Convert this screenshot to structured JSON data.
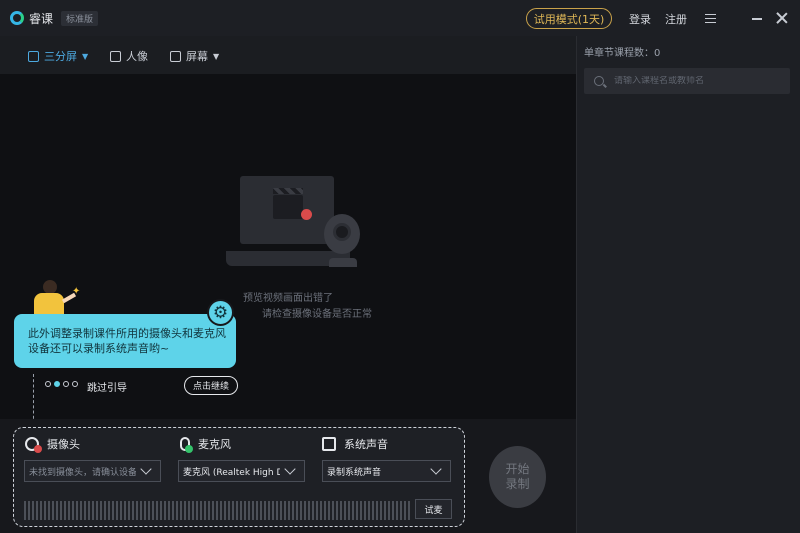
{
  "titlebar": {
    "app_name": "睿课",
    "edition": "标准版",
    "trial_mode": "试用模式(1天)",
    "login": "登录",
    "register": "注册"
  },
  "toolbar": {
    "split_label": "三分屏",
    "portrait_label": "人像",
    "screen_label": "屏幕"
  },
  "preview": {
    "error_line1": "预览视频画面出错了",
    "error_line2": "请检查摄像设备是否正常"
  },
  "guide": {
    "text": "此外调整录制课件所用的摄像头和麦克风设备还可以录制系统声音哟~",
    "skip": "跳过引导",
    "continue": "点击继续",
    "current_step": 2,
    "total_steps": 4
  },
  "devices": {
    "camera_label": "摄像头",
    "camera_value": "未找到摄像头，请确认设备...",
    "mic_label": "麦克风",
    "mic_value": "麦克风 (Realtek High D...",
    "system_label": "系统声音",
    "system_value": "录制系统声音",
    "test_label": "试麦",
    "record_label": "开始录制"
  },
  "right_panel": {
    "course_count": "单章节课程数：0",
    "search_placeholder": "请输入课程名或教师名"
  },
  "colors": {
    "accent": "#4da9e0",
    "guide_bubble": "#5ed3e9",
    "trial_gold": "#e0b857",
    "error_red": "#d94b4b",
    "ok_green": "#34c36b"
  }
}
